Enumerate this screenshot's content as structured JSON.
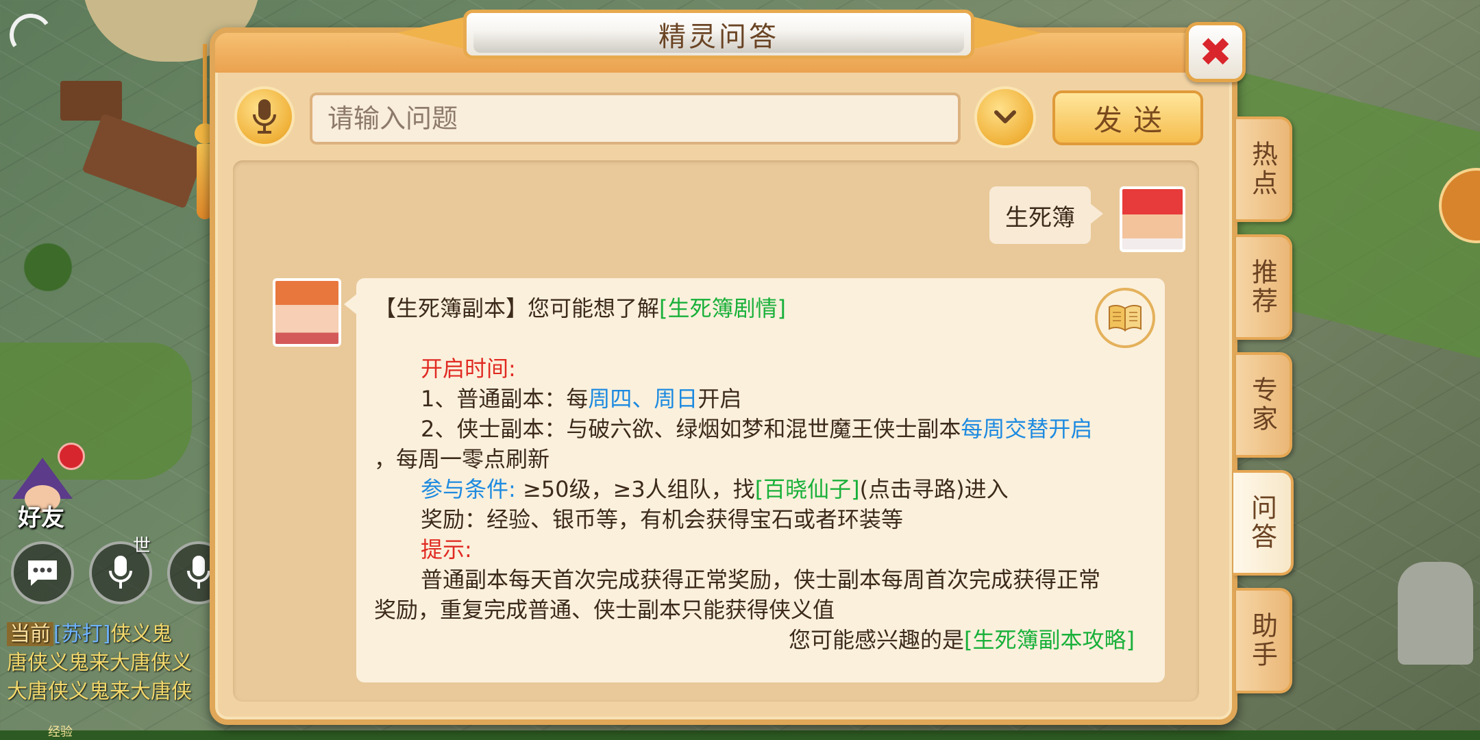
{
  "hud": {
    "friend_label": "好友",
    "world_label": "世",
    "exp_label": "经验",
    "chat_lines": [
      {
        "tag": "当前",
        "name": "[苏打]",
        "text": "侠义鬼"
      },
      {
        "tag": "",
        "name": "",
        "text": "唐侠义鬼来大唐侠义"
      },
      {
        "tag": "",
        "name": "",
        "text": "大唐侠义鬼来大唐侠"
      }
    ]
  },
  "dialog": {
    "title": "精灵问答",
    "close_icon": "close-x",
    "input_placeholder": "请输入问题",
    "send_label": "发送",
    "user_message": "生死簿",
    "answer": {
      "intro_prefix": "【生死簿副本】您可能想了解",
      "intro_link": "[生死簿剧情]",
      "open_time_label": "开启时间:",
      "item1_prefix": "1、普通副本：每",
      "item1_days": "周四、周日",
      "item1_suffix": "开启",
      "item2_prefix": "2、侠士副本：与破六欲、绿烟如梦和混世魔王侠士副本",
      "item2_highlight": "每周交替开启",
      "item2_cont": "，每周一零点刷新",
      "cond_label": "参与条件:",
      "cond_text": " ≥50级，≥3人组队，找",
      "cond_npc": "[百晓仙子]",
      "cond_suffix": "(点击寻路)进入",
      "reward_text": "奖励：经验、银币等，有机会获得宝石或者环装等",
      "tip_label": "提示:",
      "tip_text_1": "普通副本每天首次完成获得正常奖励，侠士副本每周首次完成获得正常",
      "tip_text_2": "奖励，重复完成普通、侠士副本只能获得侠义值",
      "interest_prefix": "您可能感兴趣的是",
      "interest_link": "[生死簿副本攻略]"
    }
  },
  "side_tabs": [
    {
      "label": "热点",
      "active": false
    },
    {
      "label": "推荐",
      "active": false
    },
    {
      "label": "专家",
      "active": false
    },
    {
      "label": "问答",
      "active": true
    },
    {
      "label": "助手",
      "active": false
    }
  ],
  "colors": {
    "red": "#e02a22",
    "blue": "#1d8ae0",
    "green": "#19b03a",
    "panel": "#f1d3a3",
    "accent": "#e0a758"
  }
}
